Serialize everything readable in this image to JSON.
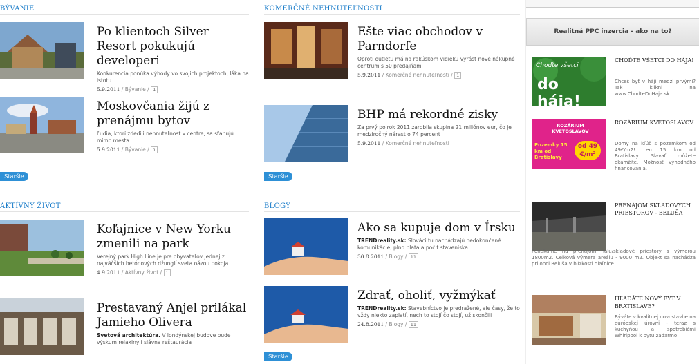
{
  "bývanie": {
    "header": "BÝVANIE",
    "articles": [
      {
        "title": "Po klientoch Silver Resort pokukujú developeri",
        "perex": "Konkurencia ponúka výhody vo svojich projektoch, lákа na istotu",
        "date": "5.9.2011",
        "category": "Bývanie",
        "comments": "1"
      },
      {
        "title": "Moskovčania žijú z prenájmu bytov",
        "perex": "Ľudia, ktorí zdedili nehnuteľnosť v centre, sa sťahujú mimo mesta",
        "date": "5.9.2011",
        "category": "Bývanie",
        "comments": "1"
      }
    ],
    "older": "Staršie"
  },
  "aktivny": {
    "header": "AKTÍVNY ŽIVOT",
    "articles": [
      {
        "title": "Koľajnice v New Yorku zmenili na park",
        "perex": "Verejný park High Line je pre obyvateľov jednej z najväčších betónových džunglí sveta oázou pokoja",
        "date": "4.9.2011",
        "category": "Aktívny život",
        "comments": "1"
      },
      {
        "title": "Prestavaný Anjel prilákal Jamieho Olivera",
        "perex_bold": "Svetová architektúra.",
        "perex": " V londýnskej budove bude výskum relaxiny i slávna reštaurácia"
      }
    ]
  },
  "komercne": {
    "header": "KOMERČNÉ NEHNUTEĽNOSTI",
    "articles": [
      {
        "title": "Ešte viac obchodov v Parndorfe",
        "perex": "Oproti outletu má na rakúskom vidieku vyrásť nové nákupné centrum s 50 predajňami",
        "date": "5.9.2011",
        "category": "Komerčné nehnuteľnosti",
        "comments": "1"
      },
      {
        "title": "BHP má rekordné zisky",
        "perex": "Za prvý polrok 2011 zarobila skupina 21 miliónov eur, čo je medziročný nárast o 74 percent",
        "date": "5.9.2011",
        "category": "Komerčné nehnuteľnosti"
      }
    ],
    "older": "Staršie"
  },
  "blogy": {
    "header": "BLOGY",
    "articles": [
      {
        "title": "Ako sa kupuje dom v Írsku",
        "perex_bold": "TRENDreality.sk:",
        "perex": " Slováci tu nachádzajú nedokončené komunikácie, plno blata a počit staveniska",
        "date": "30.8.2011",
        "category": "Blogy",
        "comments": "11"
      },
      {
        "title": "Zdrať, oholiť, vyžmýkať",
        "perex_bold": "TRENDreality.sk:",
        "perex": " Stavebníctvo je predražené, ale časy, že to vždy niekto zaplatí, nech to stojí čo stojí, už skončili",
        "date": "24.8.2011",
        "category": "Blogy",
        "comments": "11"
      }
    ],
    "older": "Staršie"
  },
  "sidebar": {
    "ppc_label": "Realitná PPC inzercia - ako na to?",
    "ads": [
      {
        "title": "CHOĎTE VŠETCI DO HÁJA!",
        "text": "Chceš byť v háji medzi prvými? Tak klikni na www.ChodteDoHaja.sk",
        "image_text_top": "Choďte všetci",
        "image_text_bottom": "do hája!"
      },
      {
        "title": "ROZÁRIUM KVETOSLAVOV",
        "text": "Domy na kľúč s pozemkom od 49€/m2! Len 15 km od Bratislavy. Slavať môžete okamžite. Možnosť výhodného financovania.",
        "image_brand": "ROZÁRIUM KVETOSLAVOV",
        "image_left": "Pozemky 15 km od Bratislavy",
        "image_price": "od 49 €/m²"
      },
      {
        "title": "PRENÁJOM SKLADOVÝCH PRIESTOROV - BELUŠA",
        "text": "Ponúkame na prenájom halu/skladové priestory s výmerou 1800m2. Celková výmera areálu - 9000 m2. Objekt sa nachádza pri obci Beluša v blízkosti diaľnice."
      },
      {
        "title": "HĽADÁTE NOVÝ BYT V BRATISLAVE?",
        "text": "Býváte v kvalitnej novostavbe na európskej úrovni - teraz s kuchyňou a spotrebičmi Whirlpool k bytu zadarmo!"
      }
    ]
  }
}
